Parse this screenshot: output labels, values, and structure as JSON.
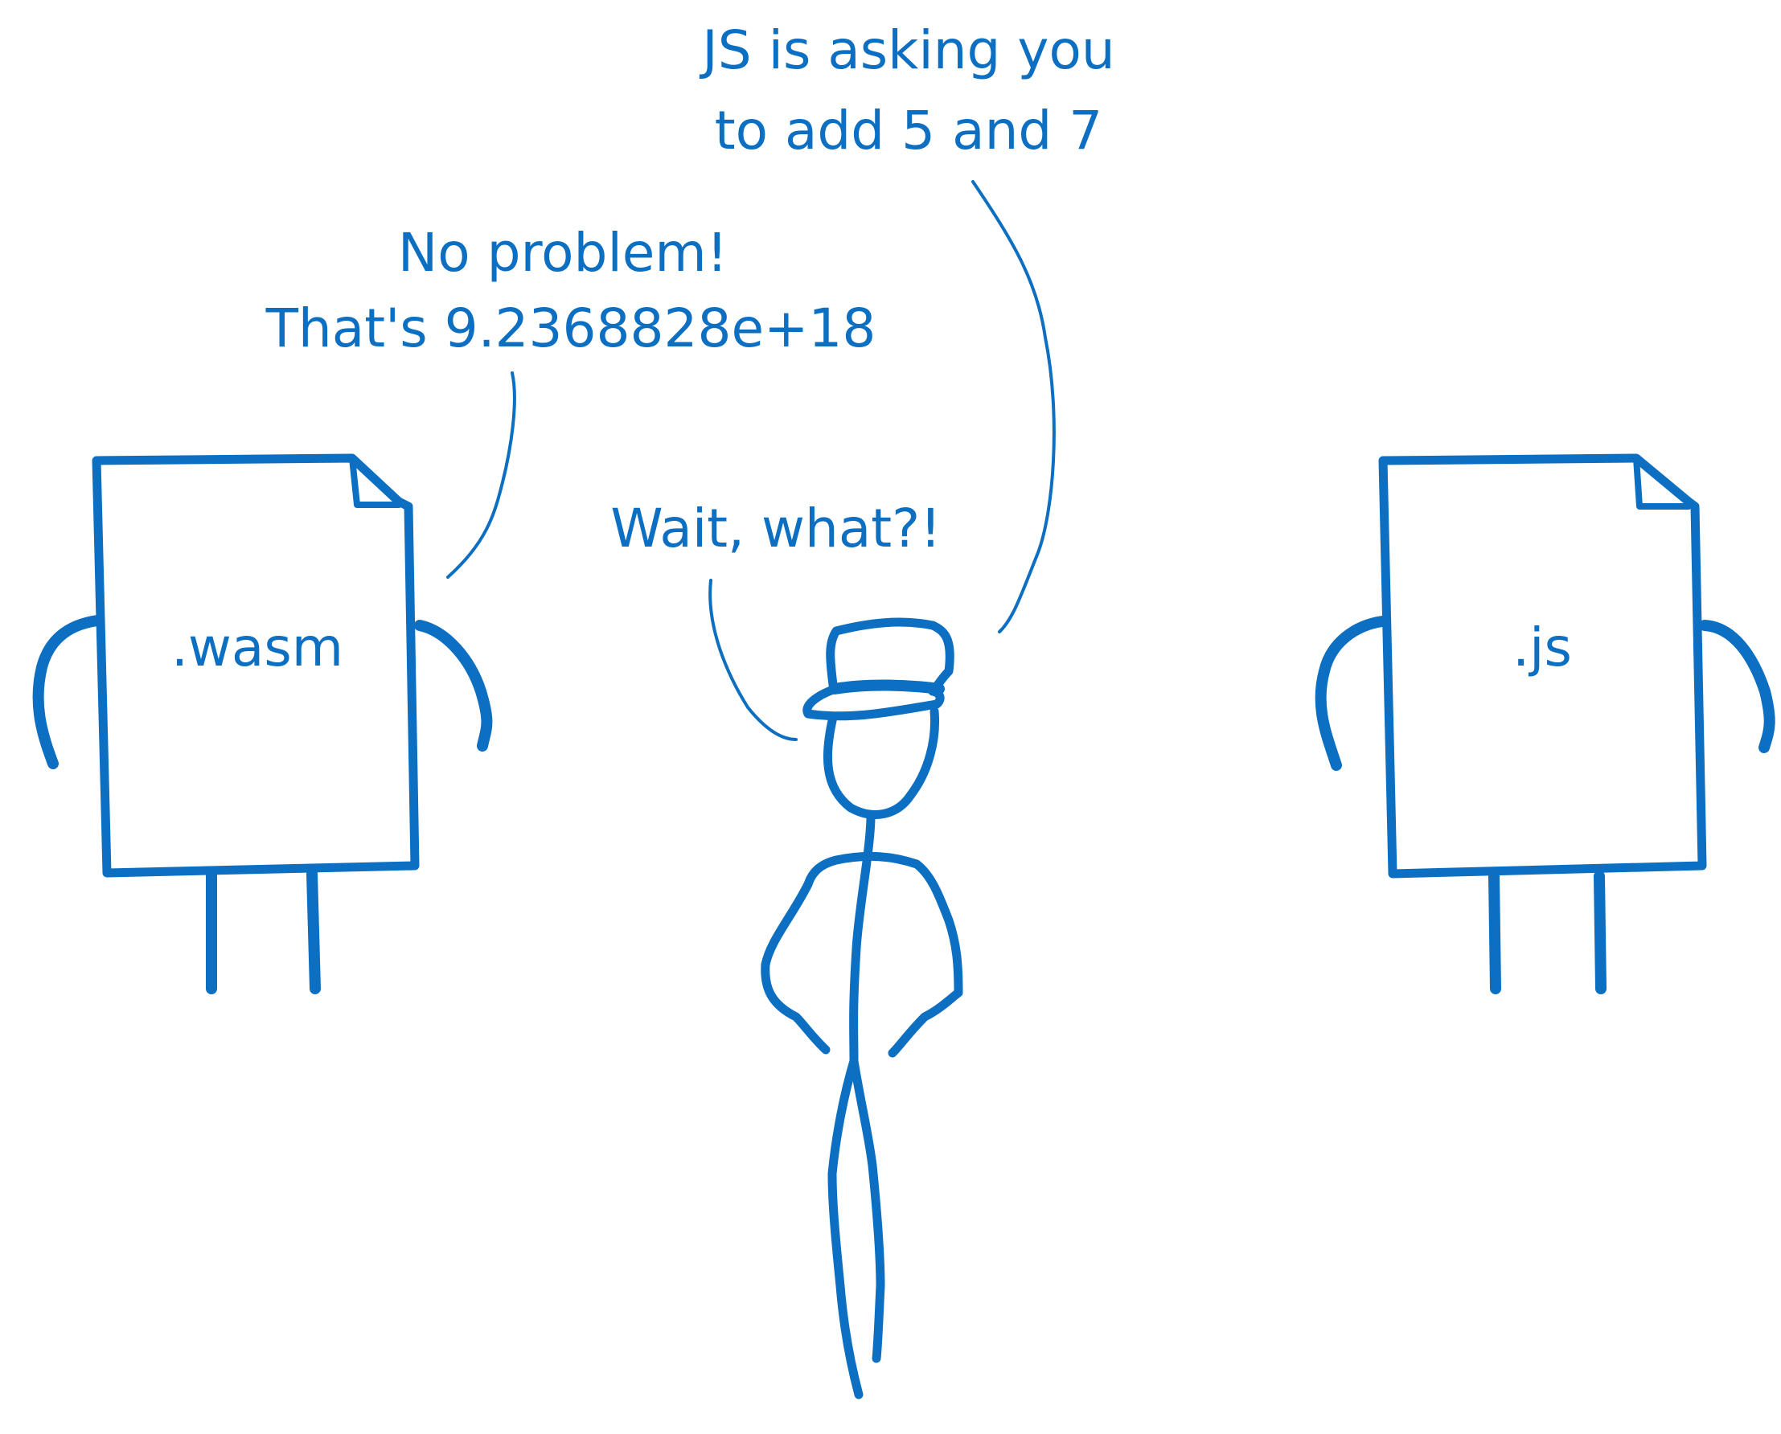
{
  "colors": {
    "ink": "#0d6fc1",
    "background": "#ffffff"
  },
  "characters": {
    "wasm": {
      "label": ".wasm",
      "icon": "file-icon"
    },
    "js": {
      "label": ".js",
      "icon": "file-icon"
    },
    "stick_figure": {
      "icon": "stick-figure-with-cap-icon"
    }
  },
  "speech": {
    "js_request": {
      "line1": "JS is asking you",
      "line2": "to add 5 and 7"
    },
    "wasm_reply": {
      "line1": "No problem!",
      "line2": "That's 9.2368828e+18"
    },
    "figure_reaction": {
      "line1": "Wait, what?!"
    }
  }
}
